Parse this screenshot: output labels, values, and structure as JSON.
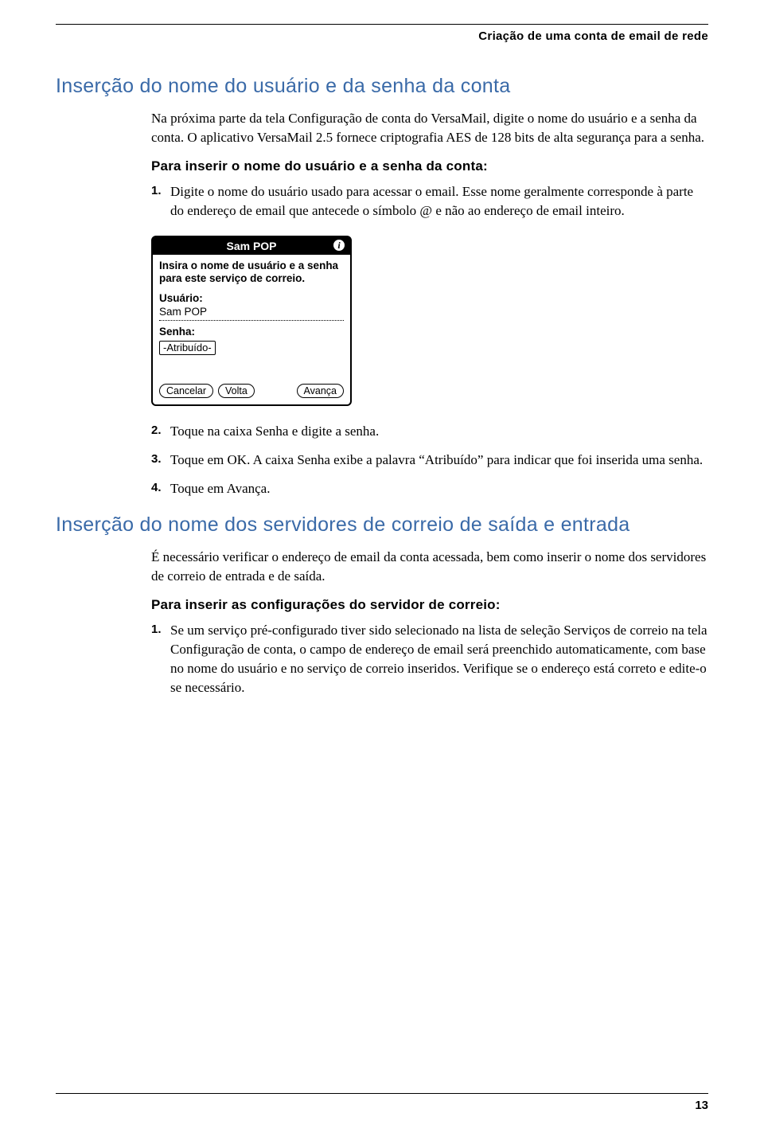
{
  "header": {
    "running_title": "Criação de uma conta de email de rede"
  },
  "section1": {
    "title": "Inserção do nome do usuário e da senha da conta",
    "para1": "Na próxima parte da tela Configuração de conta do VersaMail, digite o nome do usuário e a senha da conta. O aplicativo VersaMail 2.5 fornece criptografia AES de 128 bits de alta segurança para a senha.",
    "subhead": "Para inserir o nome do usuário e a senha da conta:",
    "step1": "Digite o nome do usuário usado para acessar o email. Esse nome geralmente corresponde à parte do endereço de email que antecede o símbolo @ e não ao endereço de email inteiro.",
    "step2": "Toque na caixa Senha e digite a senha.",
    "step3": "Toque em OK. A caixa Senha exibe a palavra “Atribuído” para indicar que foi inserida uma senha.",
    "step4": "Toque em Avança."
  },
  "device": {
    "title": "Sam POP",
    "info": "i",
    "instr": "Insira o nome de usuário e a senha para este serviço de correio.",
    "usuario_label": "Usuário:",
    "usuario_value": "Sam POP",
    "senha_label": "Senha:",
    "senha_value": "-Atribuído-",
    "btn_cancel": "Cancelar",
    "btn_back": "Volta",
    "btn_next": "Avança"
  },
  "section2": {
    "title": "Inserção do nome dos servidores de correio de saída e entrada",
    "para1": "É necessário verificar o endereço de email da conta acessada, bem como inserir o nome dos servidores de correio de entrada e de saída.",
    "subhead": "Para inserir as configurações do servidor de correio:",
    "step1": "Se um serviço pré-configurado tiver sido selecionado na lista de seleção Serviços de correio na tela Configuração de conta, o campo de endereço de email será preenchido automaticamente, com base no nome do usuário e no serviço de correio inseridos. Verifique se o endereço está correto e edite-o se necessário."
  },
  "page_number": "13"
}
